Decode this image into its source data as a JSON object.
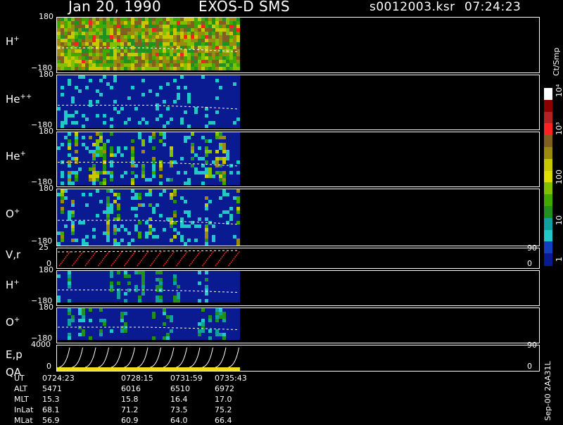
{
  "header": {
    "date": "Jan 20, 1990",
    "instrument": "EXOS-D SMS",
    "file": "s0012003.ksr",
    "time": "07:24:23"
  },
  "panels": [
    {
      "label": "H",
      "sup": "+",
      "top_tick": "180",
      "bottom_tick": "−180"
    },
    {
      "label": "He",
      "sup": "++",
      "top_tick": "180",
      "bottom_tick": "−180"
    },
    {
      "label": "He",
      "sup": "+",
      "top_tick": "180",
      "bottom_tick": "−180"
    },
    {
      "label": "O",
      "sup": "+",
      "top_tick": "180",
      "bottom_tick": "−180"
    },
    {
      "label": "V,r",
      "sup": "",
      "top_tick": "25",
      "bottom_tick": "0",
      "right_top": "90",
      "right_bottom": "0"
    },
    {
      "label": "H",
      "sup": "+",
      "top_tick": "180",
      "bottom_tick": "−180"
    },
    {
      "label": "O",
      "sup": "+",
      "top_tick": "180",
      "bottom_tick": "−180"
    },
    {
      "label": "E,p",
      "sup": "",
      "label2": "QA",
      "top_tick": "4000",
      "bottom_tick": "0",
      "right_top": "90",
      "right_bottom": "0"
    }
  ],
  "colorbar": {
    "unit": "Ct/Smp",
    "ticks": [
      "10⁴",
      "10³",
      "100",
      "10",
      "1"
    ],
    "colors": [
      "#ffffff",
      "#8b0000",
      "#b22222",
      "#ff2020",
      "#806020",
      "#9a8a10",
      "#c8c800",
      "#e0e000",
      "#80c000",
      "#40a800",
      "#209020",
      "#10a0a0",
      "#20c8c8",
      "#1040c0",
      "#0a1a90"
    ]
  },
  "footer": {
    "labels": [
      "UT",
      "ALT",
      "MLT",
      "InLat",
      "MLat"
    ],
    "columns": [
      [
        "0724:23",
        "5471",
        "15.3",
        "68.1",
        "56.9"
      ],
      [
        "0728:15",
        "6016",
        "15.8",
        "71.2",
        "60.9"
      ],
      [
        "0731:59",
        "6510",
        "16.4",
        "73.5",
        "64.0"
      ],
      [
        "0735:43",
        "6972",
        "17.0",
        "75.2",
        "66.4"
      ]
    ],
    "version": "Sep-00 2AA31L"
  },
  "chart_data": {
    "type": "heatmap",
    "x_ticks": [
      "0724:23",
      "0728:15",
      "0731:59",
      "0735:43"
    ],
    "panels": [
      "H+",
      "He++",
      "He+",
      "O+",
      "V,r",
      "H+",
      "O+",
      "E,p / QA"
    ],
    "colorbar_unit": "Ct/Smp",
    "colorbar_ticks": [
      "1",
      "10",
      "100",
      "10³",
      "10⁴"
    ]
  }
}
